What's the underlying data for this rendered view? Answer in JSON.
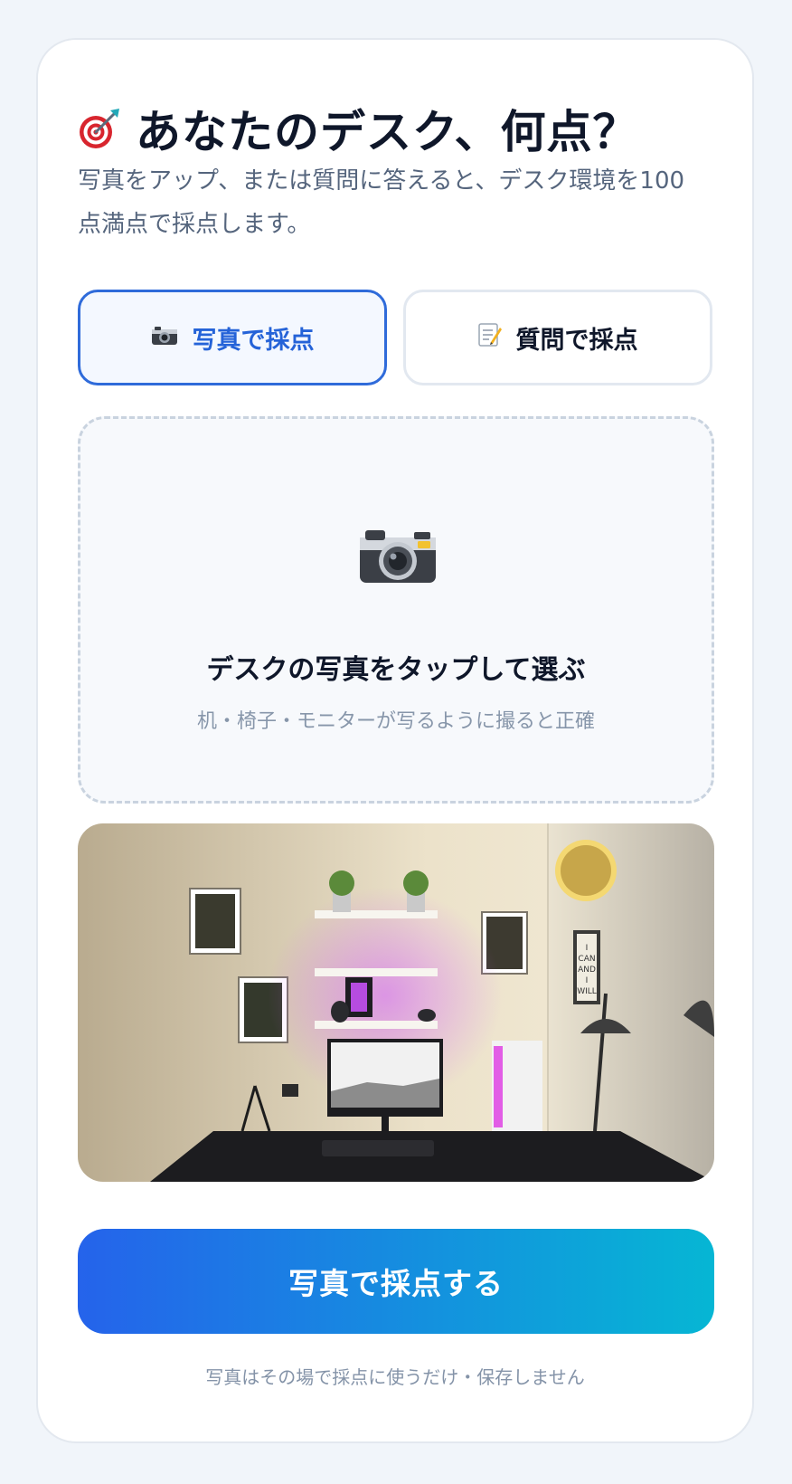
{
  "header": {
    "icon": "target-icon",
    "title": "あなたのデスク、何点？",
    "subtitle": "写真をアップ、または質問に答えると、デスク環境を100点満点で採点します。"
  },
  "tabs": [
    {
      "icon": "camera-icon",
      "label": "写真で採点",
      "active": true
    },
    {
      "icon": "memo-icon",
      "label": "質問で採点",
      "active": false
    }
  ],
  "upload": {
    "icon": "camera-icon",
    "title": "デスクの写真をタップして選ぶ",
    "hint": "机・椅子・モニターが写るように撮ると正確"
  },
  "preview": {
    "icon": "desk-photo-preview",
    "wall_poster_text": [
      "I",
      "CAN",
      "AND",
      "I",
      "WILL"
    ]
  },
  "submit": {
    "label": "写真で採点する"
  },
  "footer_note": "写真はその場で採点に使うだけ・保存しません",
  "colors": {
    "accent": "#2563eb",
    "accent_end": "#06b6d4",
    "title": "#0f172a",
    "muted": "#55657d"
  }
}
